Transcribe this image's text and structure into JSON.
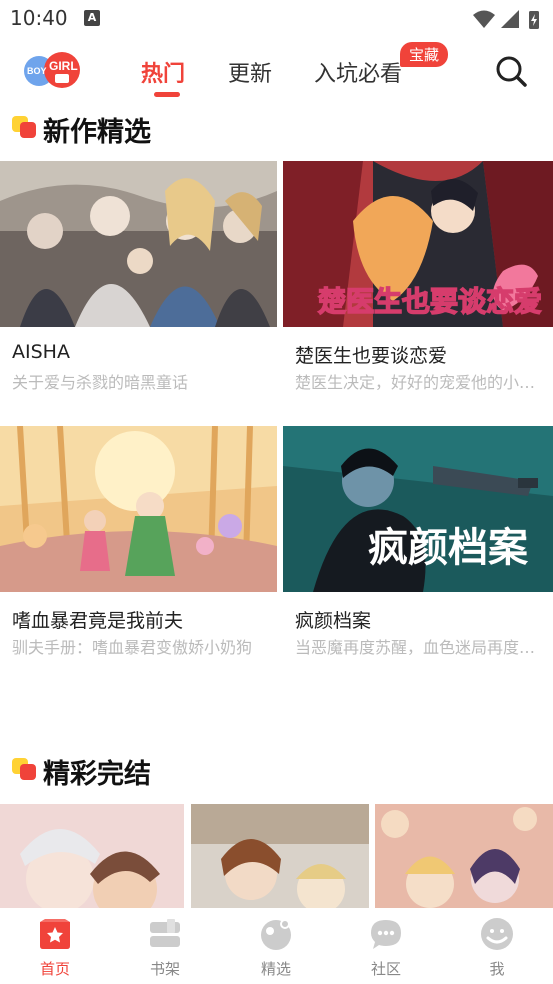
{
  "status_bar": {
    "time": "10:40",
    "notification_badge": "A"
  },
  "header": {
    "logo_text_boy": "BOY",
    "logo_text_girl": "GIRL",
    "tabs": [
      {
        "label": "热门",
        "active": true
      },
      {
        "label": "更新",
        "active": false
      },
      {
        "label": "入坑必看",
        "active": false
      }
    ],
    "tab_badge": "宝藏",
    "search_icon": "search-icon"
  },
  "sections": [
    {
      "title": "新作精选",
      "items": [
        {
          "title": "AISHA",
          "desc": "关于爱与杀戮的暗黑童话"
        },
        {
          "title": "楚医生也要谈恋爱",
          "desc": "楚医生决定，好好的宠爱他的小娇妻",
          "cover_text": "楚医生也要谈恋爱"
        },
        {
          "title": "嗜血暴君竟是我前夫",
          "desc": "驯夫手册：嗜血暴君变傲娇小奶狗"
        },
        {
          "title": "疯颜档案",
          "desc": "当恶魔再度苏醒，血色迷局再度开启",
          "cover_text": "疯颜档案"
        }
      ]
    },
    {
      "title": "精彩完结"
    }
  ],
  "bottom_nav": [
    {
      "label": "首页",
      "icon": "home-star-icon",
      "active": true
    },
    {
      "label": "书架",
      "icon": "bookshelf-icon",
      "active": false
    },
    {
      "label": "精选",
      "icon": "featured-planet-icon",
      "active": false
    },
    {
      "label": "社区",
      "icon": "community-chat-icon",
      "active": false
    },
    {
      "label": "我",
      "icon": "profile-icon",
      "active": false
    }
  ],
  "colors": {
    "accent": "#f0433a",
    "muted_text": "#bbbbbb",
    "inactive_icon": "#cccccc"
  }
}
